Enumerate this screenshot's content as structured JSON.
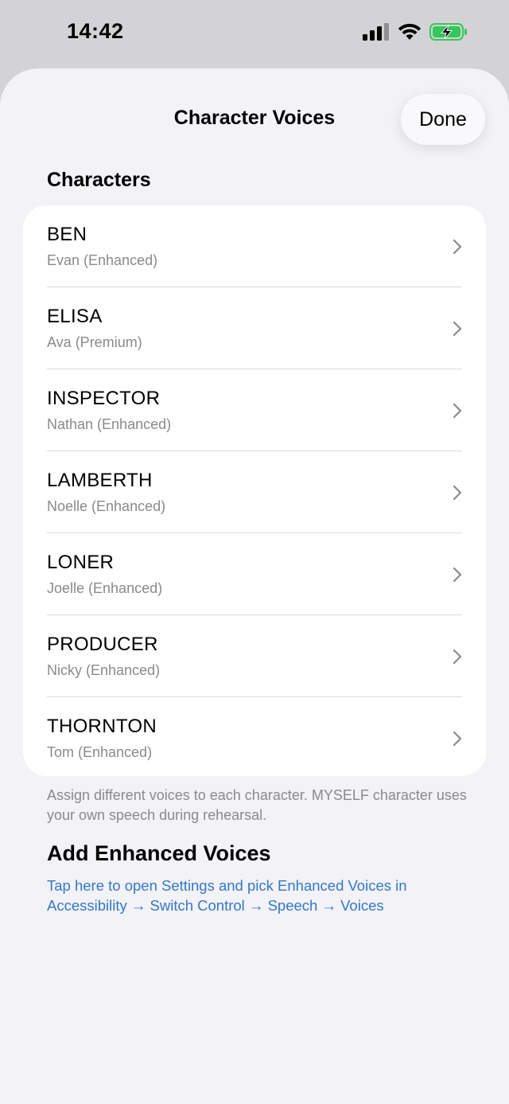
{
  "status_bar": {
    "time": "14:42"
  },
  "nav": {
    "title": "Character Voices",
    "done_label": "Done"
  },
  "section": {
    "header": "Characters",
    "footer": "Assign different voices to each character. MYSELF character uses your own speech during rehearsal."
  },
  "characters": [
    {
      "name": "BEN",
      "voice": "Evan (Enhanced)"
    },
    {
      "name": "ELISA",
      "voice": "Ava (Premium)"
    },
    {
      "name": "INSPECTOR",
      "voice": "Nathan (Enhanced)"
    },
    {
      "name": "LAMBERTH",
      "voice": "Noelle (Enhanced)"
    },
    {
      "name": "LONER",
      "voice": "Joelle (Enhanced)"
    },
    {
      "name": "PRODUCER",
      "voice": "Nicky (Enhanced)"
    },
    {
      "name": "THORNTON",
      "voice": "Tom (Enhanced)"
    }
  ],
  "enhanced": {
    "title": "Add Enhanced Voices",
    "link": "Tap here to open Settings and pick Enhanced Voices in Accessibility → Switch Control → Speech → Voices"
  },
  "colors": {
    "link": "#3478c8",
    "battery_fill": "#34c759"
  }
}
